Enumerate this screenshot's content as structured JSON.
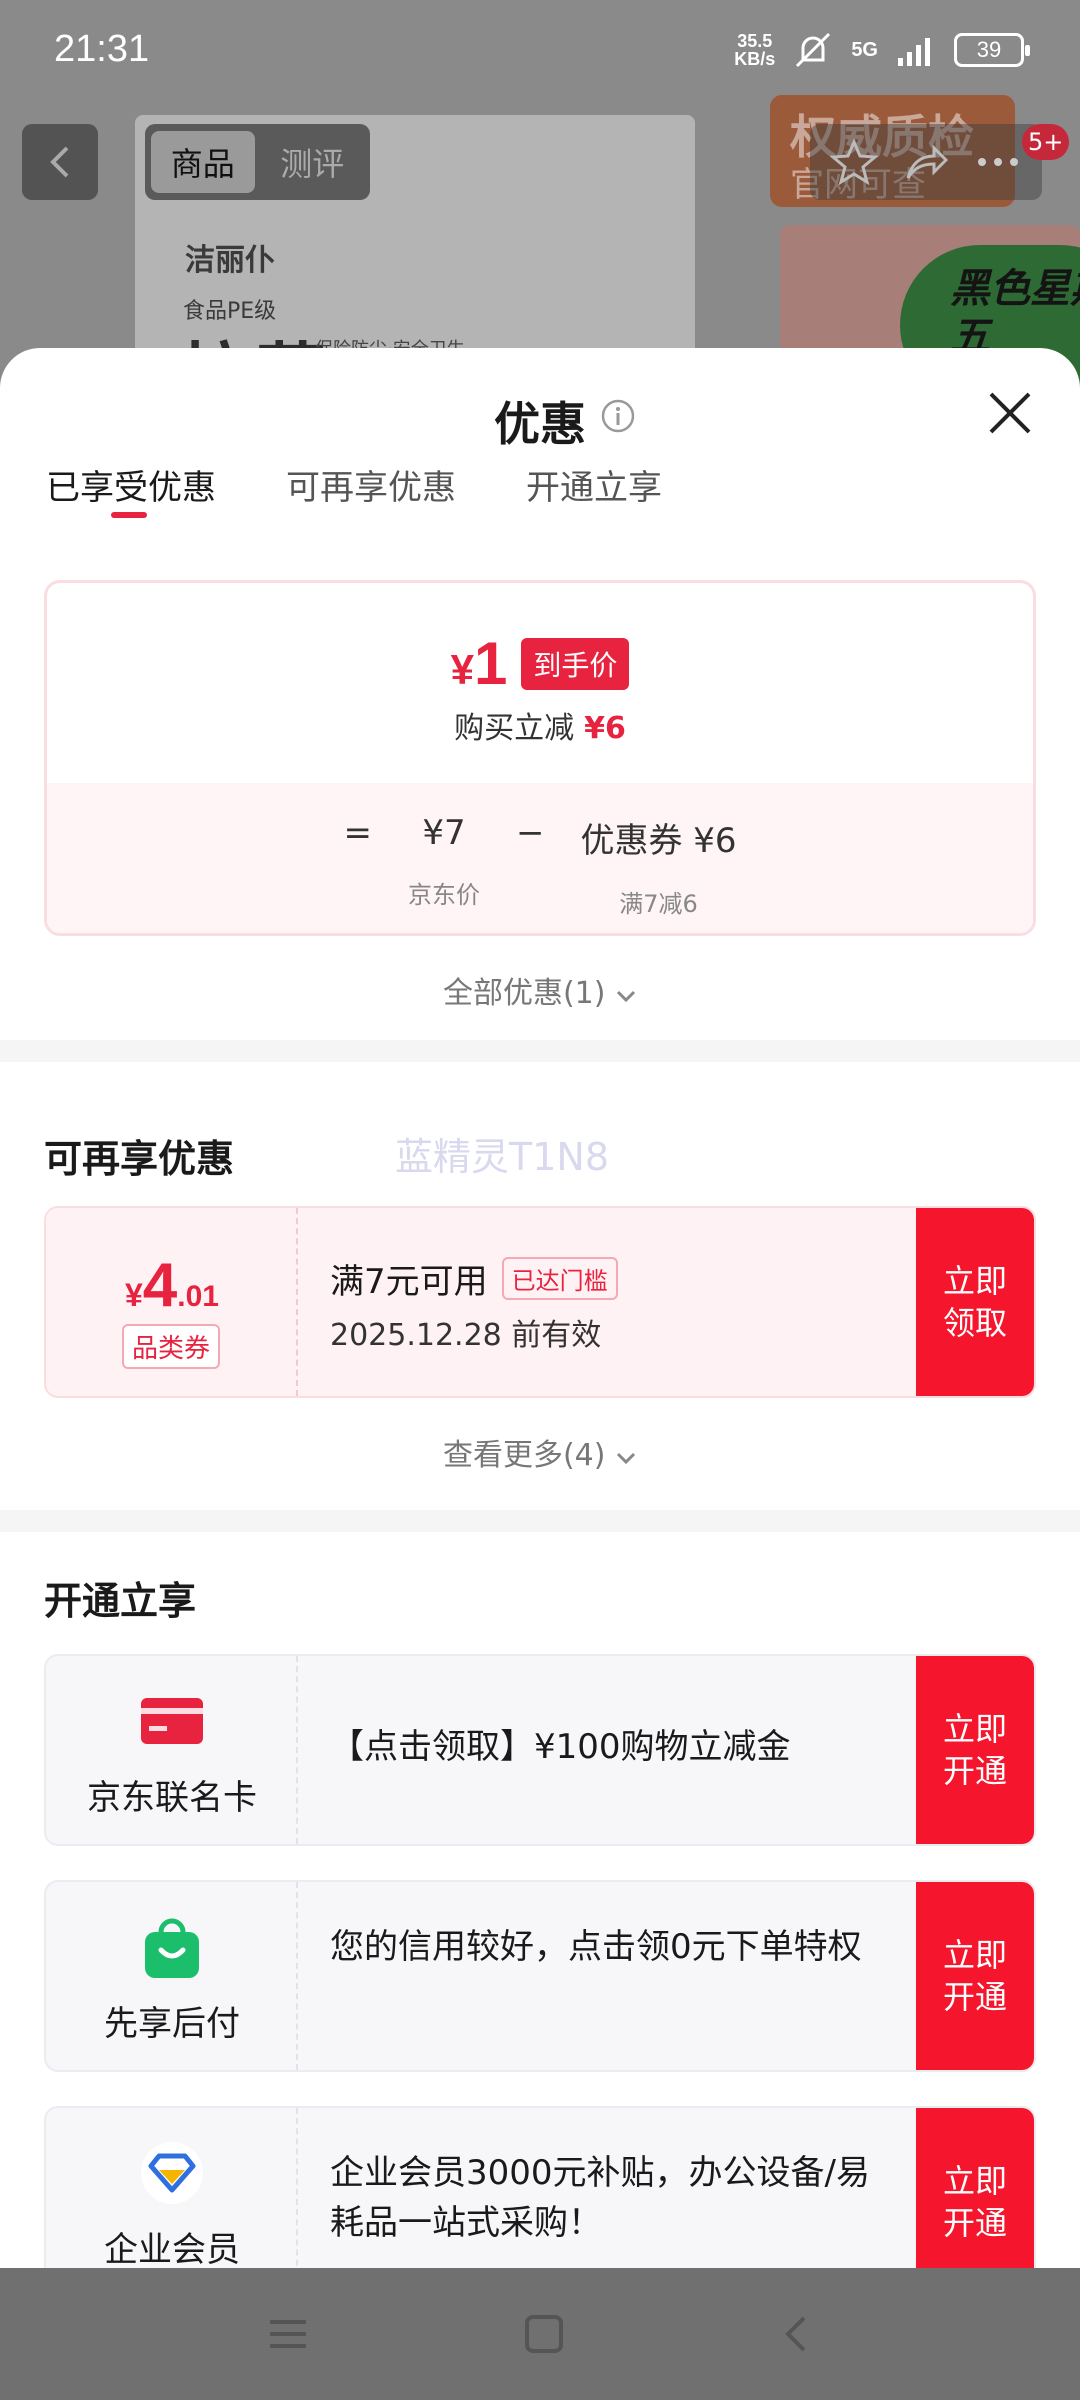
{
  "status_bar": {
    "time": "21:31",
    "net_speed_value": "35.5",
    "net_speed_unit": "KB/s",
    "network": "5G",
    "battery": "39"
  },
  "background": {
    "tabs": [
      "商品",
      "测评"
    ],
    "more_badge": "5+",
    "product_brand": "洁丽仆",
    "product_sub": "食品PE级",
    "product_big": "拉菜",
    "product_small": "保险防尘·安全卫生",
    "badge_line1": "权威质检",
    "badge_line2": "官网可查",
    "promo_text": "黑色星期五"
  },
  "sheet": {
    "title": "优惠",
    "tabs": [
      "已享受优惠",
      "可再享优惠",
      "开通立享"
    ],
    "price_card": {
      "currency": "¥",
      "final_price": "1",
      "final_tag": "到手价",
      "reduction_label": "购买立减",
      "reduction_value": "¥6",
      "equals": "=",
      "jd_price": "¥7",
      "jd_price_label": "京东价",
      "minus": "−",
      "coupon_label": "优惠券 ¥6",
      "coupon_condition": "满7减6"
    },
    "all_discounts": "全部优惠(1)"
  },
  "more_section": {
    "title": "可再享优惠",
    "watermark": "蓝精灵T1N8",
    "coupon": {
      "currency": "¥",
      "amount_int": "4",
      "amount_dec": ".01",
      "type": "品类券",
      "condition": "满7元可用",
      "flag": "已达门槛",
      "expiry": "2025.12.28 前有效",
      "button_line1": "立即",
      "button_line2": "领取"
    },
    "see_more": "查看更多(4)"
  },
  "open_section": {
    "title": "开通立享",
    "items": [
      {
        "name": "京东联名卡",
        "text": "【点击领取】¥100购物立减金",
        "button_line1": "立即",
        "button_line2": "开通"
      },
      {
        "name": "先享后付",
        "text": "您的信用较好，点击领0元下单特权",
        "button_line1": "立即",
        "button_line2": "开通"
      },
      {
        "name": "企业会员",
        "text": "企业会员3000元补贴，办公设备/易耗品一站式采购！",
        "button_line1": "立即",
        "button_line2": "开通"
      }
    ]
  },
  "colors": {
    "accent": "#e8233f",
    "button_red": "#f5162d"
  }
}
